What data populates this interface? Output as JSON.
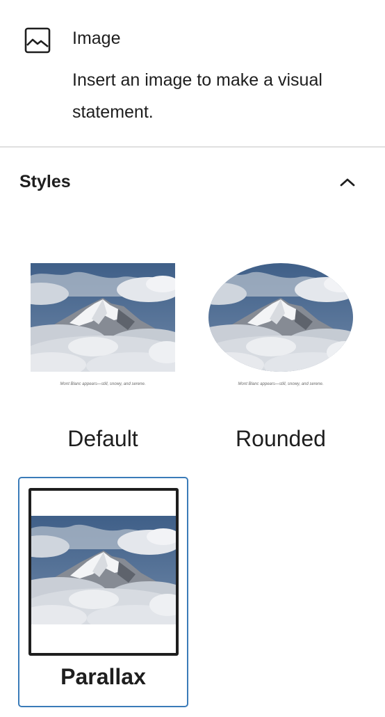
{
  "block": {
    "icon": "image-icon",
    "title": "Image",
    "description": "Insert an image to make a visual statement."
  },
  "styles_panel": {
    "title": "Styles",
    "toggle_icon": "chevron-up-icon",
    "expanded": true,
    "items": [
      {
        "label": "Default",
        "caption": "Mont Blanc appears—still, snowy, and serene.",
        "selected": false
      },
      {
        "label": "Rounded",
        "caption": "Mont Blanc appears—still, snowy, and serene.",
        "selected": false
      },
      {
        "label": "Parallax",
        "selected": true
      }
    ]
  },
  "colors": {
    "selected_border": "#3a7bb8",
    "text": "#1e1e1e",
    "divider": "#e0e0e0"
  }
}
